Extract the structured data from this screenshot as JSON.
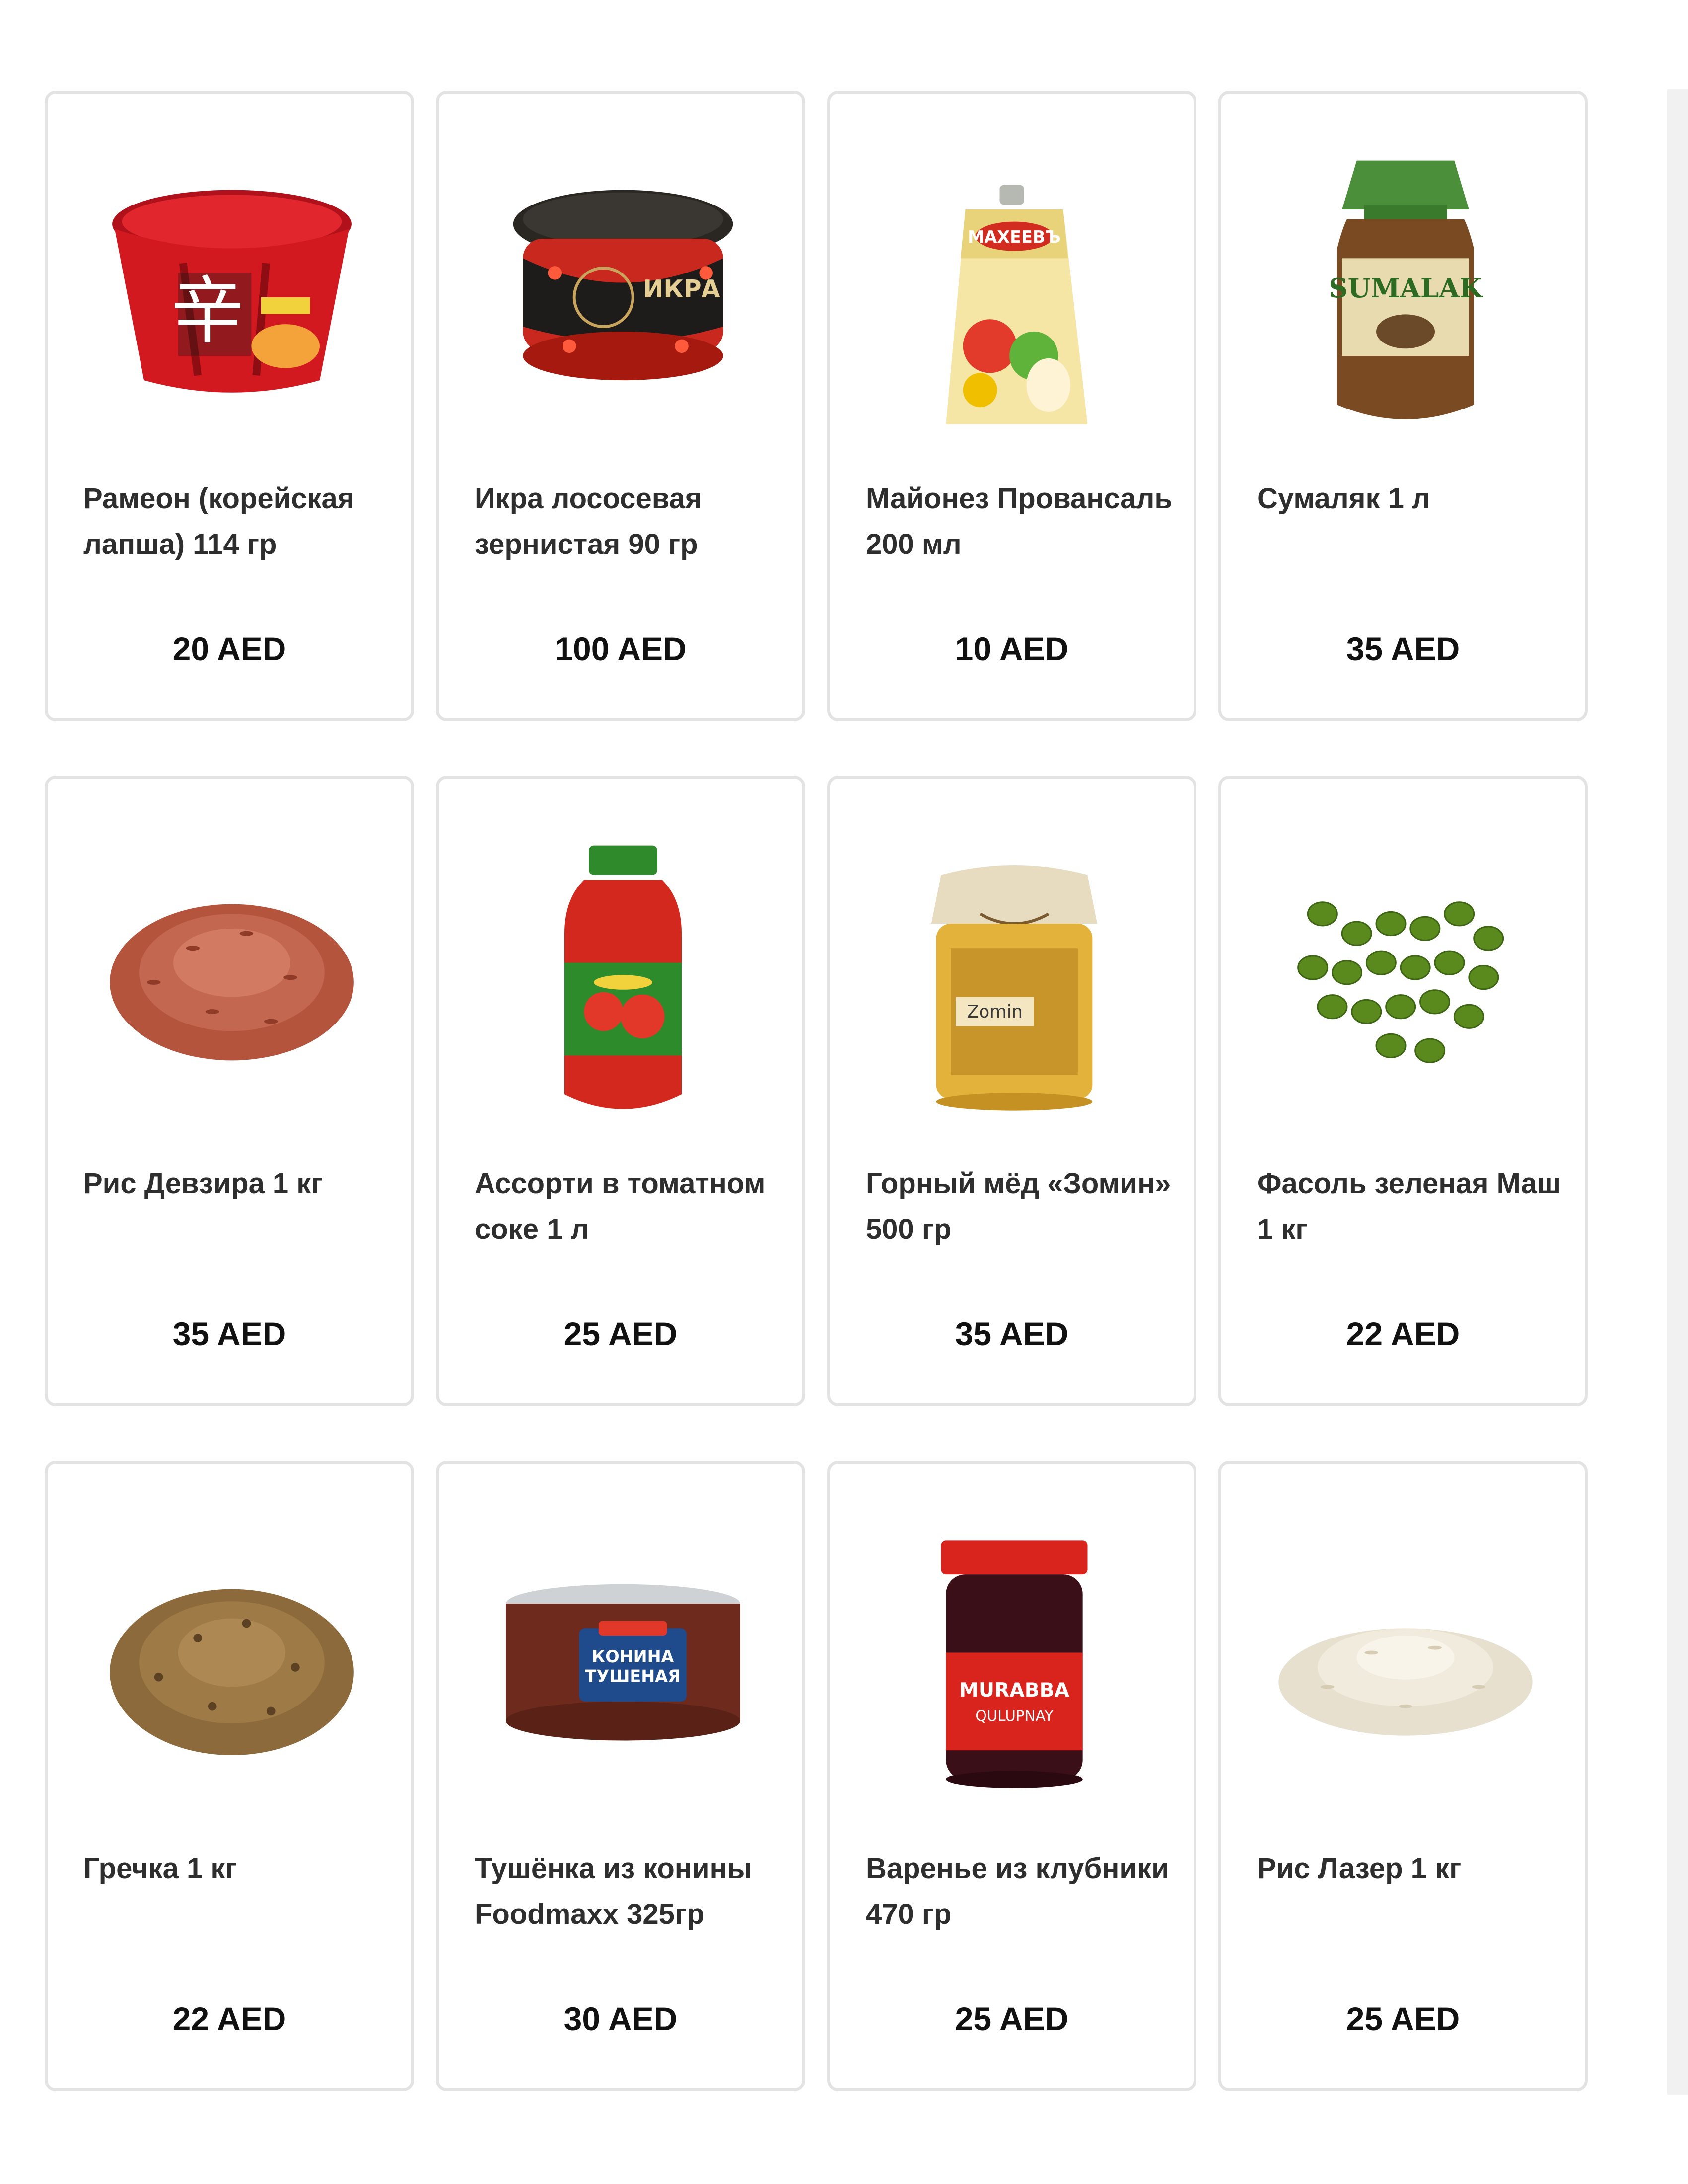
{
  "products": [
    {
      "title": "Рамеон (корейская лапша) 114 гр",
      "price": "20 AED",
      "icon": "ramen-bowl-icon"
    },
    {
      "title": "Икра лососевая зернистая 90 гр",
      "price": "100 AED",
      "icon": "caviar-jar-icon"
    },
    {
      "title": "Майонез Провансаль 200 мл",
      "price": "10 AED",
      "icon": "mayonnaise-pouch-icon"
    },
    {
      "title": "Сумаляк 1 л",
      "price": "35 AED",
      "icon": "sumalak-jar-icon"
    },
    {
      "title": "Рис Девзира 1 кг",
      "price": "35 AED",
      "icon": "red-rice-pile-icon"
    },
    {
      "title": "Ассорти в томатном соке 1 л",
      "price": "25 AED",
      "icon": "tomato-jar-icon"
    },
    {
      "title": "Горный мёд «Зомин» 500 гр",
      "price": "35 AED",
      "icon": "honey-jar-icon"
    },
    {
      "title": "Фасоль зеленая Маш 1 кг",
      "price": "22 AED",
      "icon": "mung-beans-icon"
    },
    {
      "title": "Гречка 1 кг",
      "price": "22 AED",
      "icon": "buckwheat-pile-icon"
    },
    {
      "title": "Тушёнка из конины Foodmaxx 325гр",
      "price": "30 AED",
      "icon": "meat-can-icon"
    },
    {
      "title": "Варенье из клубники 470 гр",
      "price": "25 AED",
      "icon": "strawberry-jam-jar-icon"
    },
    {
      "title": "Рис Лазер 1 кг",
      "price": "25 AED",
      "icon": "white-rice-pile-icon"
    }
  ]
}
